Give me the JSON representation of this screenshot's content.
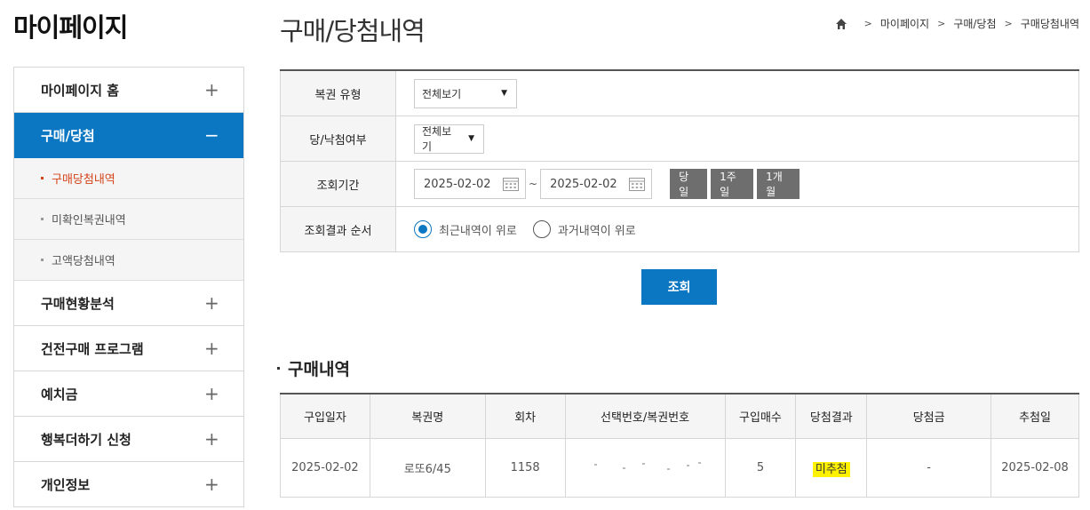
{
  "sidebar": {
    "title": "마이페이지",
    "items": [
      {
        "label": "마이페이지 홈",
        "toggle": "+"
      },
      {
        "label": "구매/당첨",
        "toggle": "−"
      },
      {
        "label": "구매현황분석",
        "toggle": "+"
      },
      {
        "label": "건전구매 프로그램",
        "toggle": "+"
      },
      {
        "label": "예치금",
        "toggle": "+"
      },
      {
        "label": "행복더하기 신청",
        "toggle": "+"
      },
      {
        "label": "개인정보",
        "toggle": "+"
      }
    ],
    "sub_items": [
      {
        "label": "구매당첨내역"
      },
      {
        "label": "미확인복권내역"
      },
      {
        "label": "고액당첨내역"
      }
    ]
  },
  "header": {
    "title": "구매/당첨내역",
    "breadcrumb": [
      "마이페이지",
      "구매/당첨",
      "구매당첨내역"
    ]
  },
  "form": {
    "lottery_type": {
      "label": "복권 유형",
      "value": "전체보기"
    },
    "win_status": {
      "label": "당/낙첨여부",
      "value": "전체보기"
    },
    "period": {
      "label": "조회기간",
      "start": "2025-02-02",
      "tilde": "~",
      "end": "2025-02-02",
      "buttons": [
        "당일",
        "1주일",
        "1개월"
      ]
    },
    "order": {
      "label": "조회결과 순서",
      "options": [
        "최근내역이 위로",
        "과거내역이 위로"
      ],
      "selected_index": 0
    },
    "search_label": "조회"
  },
  "results": {
    "title": "구매내역",
    "columns": [
      "구입일자",
      "복권명",
      "회차",
      "선택번호/복권번호",
      "구입매수",
      "당첨결과",
      "당첨금",
      "추첨일"
    ],
    "rows": [
      {
        "date": "2025-02-02",
        "name": "로또6/45",
        "round": "1158",
        "numbers": "",
        "count": "5",
        "result": "미추첨",
        "prize": "-",
        "draw_date": "2025-02-08"
      }
    ]
  },
  "colors": {
    "accent": "#0b77c2",
    "current_sub": "#d4431a",
    "highlight": "#fff200",
    "period_button": "#6e6e6e"
  }
}
